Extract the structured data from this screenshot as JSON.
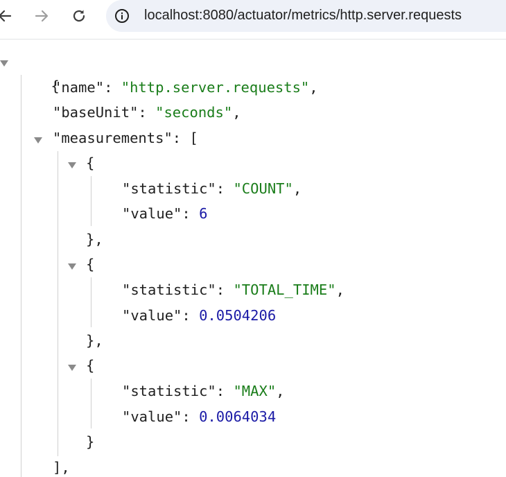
{
  "browser": {
    "url": "localhost:8080/actuator/metrics/http.server.requests"
  },
  "json": {
    "open_brace": "{",
    "name_key": "\"name\"",
    "name_value": "\"http.server.requests\"",
    "baseunit_key": "\"baseUnit\"",
    "baseunit_value": "\"seconds\"",
    "measurements_key": "\"measurements\"",
    "measurements_open": "[",
    "measurements_close": "],",
    "items": [
      {
        "statistic_key": "\"statistic\"",
        "statistic_value": "\"COUNT\"",
        "value_key": "\"value\"",
        "value": "6",
        "close": "},"
      },
      {
        "statistic_key": "\"statistic\"",
        "statistic_value": "\"TOTAL_TIME\"",
        "value_key": "\"value\"",
        "value": "0.0504206",
        "close": "},"
      },
      {
        "statistic_key": "\"statistic\"",
        "statistic_value": "\"MAX\"",
        "value_key": "\"value\"",
        "value": "0.0064034",
        "close": "}"
      }
    ]
  },
  "colors": {
    "string": "#1a7d1a",
    "number": "#1a1aa6",
    "key": "#1f1f1f",
    "omnibox": "#eef1f8"
  },
  "icons": {
    "back": "back-arrow-icon",
    "forward": "forward-arrow-icon",
    "reload": "reload-icon",
    "site_info": "site-info-icon",
    "collapse": "collapse-triangle-icon"
  }
}
